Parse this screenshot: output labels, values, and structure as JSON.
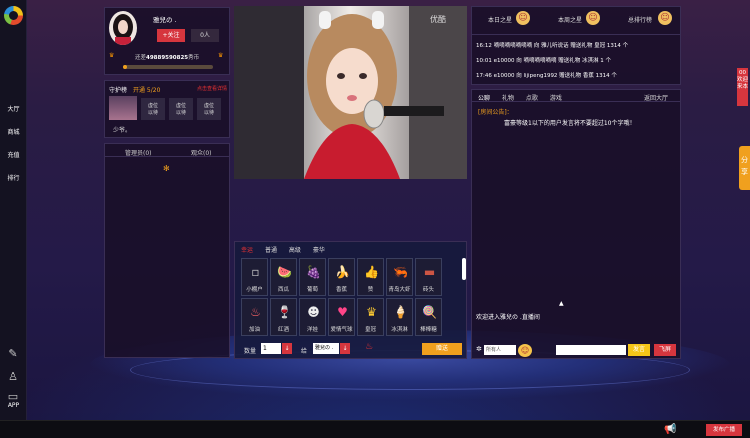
{
  "nav": {
    "items": [
      "大厅",
      "商城",
      "充值",
      "排行"
    ],
    "bottom_app": "APP"
  },
  "anchor": {
    "name": "雅兒の .",
    "follow": "+关注",
    "fans": "0人",
    "coins_prefix": "还差",
    "coins_value": "49889590825",
    "coins_suffix": "秀币"
  },
  "guard": {
    "title": "守护榜",
    "open": "开通 5/20",
    "rule": "点击查看详情",
    "slots": [
      "虚位\n以待",
      "虚位\n以待",
      "虚位\n以待"
    ],
    "motto": "少爷。"
  },
  "viewers": {
    "admins": "管理员(0)",
    "audience": "观众(0)"
  },
  "video": {
    "watermark": "优酷"
  },
  "rank": {
    "tabs": [
      "本日之星",
      "本周之星",
      "总排行榜"
    ]
  },
  "gift_feed": [
    "16:12 嘀嘀嘀嘀嘀嘀嘀 向 雅儿听说话 赠送礼物 皇冠 1314 个",
    "10:01 e10000 向 嘀嘀嘀嘀嘀嘀 赠送礼物 冰淇淋 1 个",
    "17:46 e10000 向 lijipeng1992 赠送礼物 香蕉 1314 个"
  ],
  "chat": {
    "tabs": [
      "公聊",
      "礼物",
      "点歌",
      "游戏"
    ],
    "back": "返回大厅",
    "notice_label": "[房间公告]：",
    "notice_text": "富豪等级1以下的用户发言将不要超过10个字哦！",
    "welcome": "欢迎进入雅兒の .直播间",
    "target": "所有人",
    "send": "发言",
    "fly": "飞屏"
  },
  "gift_panel": {
    "tabs": [
      "幸运",
      "普通",
      "高级",
      "豪华"
    ],
    "row1": [
      {
        "name": "小棚户",
        "icon": "▫",
        "color": "#ccc"
      },
      {
        "name": "西瓜",
        "icon": "🍉",
        "color": "#e33"
      },
      {
        "name": "葡萄",
        "icon": "🍇",
        "color": "#84c"
      },
      {
        "name": "香蕉",
        "icon": "🍌",
        "color": "#fd3"
      },
      {
        "name": "赞",
        "icon": "👍",
        "color": "#fa3"
      },
      {
        "name": "青岛大虾",
        "icon": "🦐",
        "color": "#f74"
      },
      {
        "name": "砖头",
        "icon": "▬",
        "color": "#c54"
      }
    ],
    "row2": [
      {
        "name": "加油",
        "icon": "♨",
        "color": "#f66"
      },
      {
        "name": "红酒",
        "icon": "🍷",
        "color": "#c23"
      },
      {
        "name": "洋娃",
        "icon": "☻",
        "color": "#eee"
      },
      {
        "name": "爱情气球",
        "icon": "♥",
        "color": "#f48"
      },
      {
        "name": "皇冠",
        "icon": "♛",
        "color": "#fc3"
      },
      {
        "name": "冰淇淋",
        "icon": "🍦",
        "color": "#fbe"
      },
      {
        "name": "棒棒糖",
        "icon": "🍭",
        "color": "#f6a"
      }
    ],
    "qty_label": "数量",
    "qty_value": "1",
    "to_label": "给",
    "to_value": "雅兒の .",
    "give": "赠送"
  },
  "side": {
    "promo": "00 欢迎来本",
    "share": "分享"
  },
  "bottom": {
    "broadcast": "发布广播"
  },
  "colors": {
    "accent_red": "#d6363e",
    "orange": "#f0a01e",
    "gold": "#f2c219"
  }
}
